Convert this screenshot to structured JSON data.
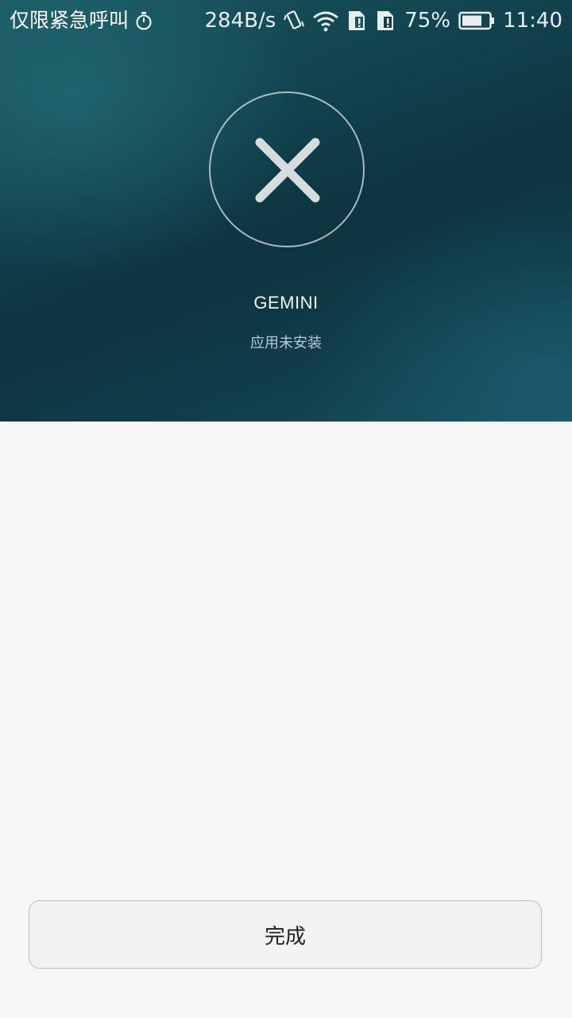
{
  "status_bar": {
    "carrier_text": "仅限紧急呼叫",
    "net_speed": "284B/s",
    "battery_percent": "75%",
    "battery_level": 0.75,
    "time": "11:40",
    "icons": [
      "timer-icon",
      "vibrate-icon",
      "wifi-icon",
      "sim1-alert-icon",
      "sim2-alert-icon",
      "battery-icon"
    ]
  },
  "result": {
    "icon": "close-icon",
    "app_name": "GEMINI",
    "message": "应用未安装"
  },
  "actions": {
    "done_label": "完成"
  }
}
